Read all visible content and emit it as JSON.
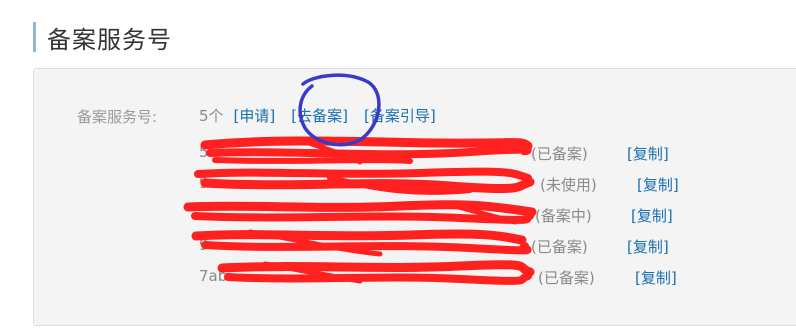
{
  "header": {
    "title": "备案服务号"
  },
  "filing": {
    "label": "备案服务号:",
    "count": "5个",
    "links": {
      "apply": "[申请]",
      "go_file": "[去备案]",
      "guide": "[备案引导]"
    },
    "entries": [
      {
        "code_visible": "5",
        "status": "(已备案)",
        "copy": "[复制]"
      },
      {
        "code_visible": "9",
        "status": "(未使用)",
        "copy": "[复制]"
      },
      {
        "code_visible": "",
        "status": "(备案中)",
        "copy": "[复制]"
      },
      {
        "code_visible": "9",
        "status": "(已备案)",
        "copy": "[复制]"
      },
      {
        "code_visible": "7ab",
        "status": "(已备案)",
        "copy": "[复制]"
      }
    ]
  },
  "colors": {
    "link": "#1a6fb0",
    "muted": "#8a8a8a",
    "redaction": "#ff2020",
    "circle": "#3a3ac8",
    "accent_bar": "#8fb6d6"
  },
  "annotations": {
    "redaction_marks": "red scribbles over service numbers",
    "circle_mark": "blue hand-drawn circle around [去备案]"
  }
}
